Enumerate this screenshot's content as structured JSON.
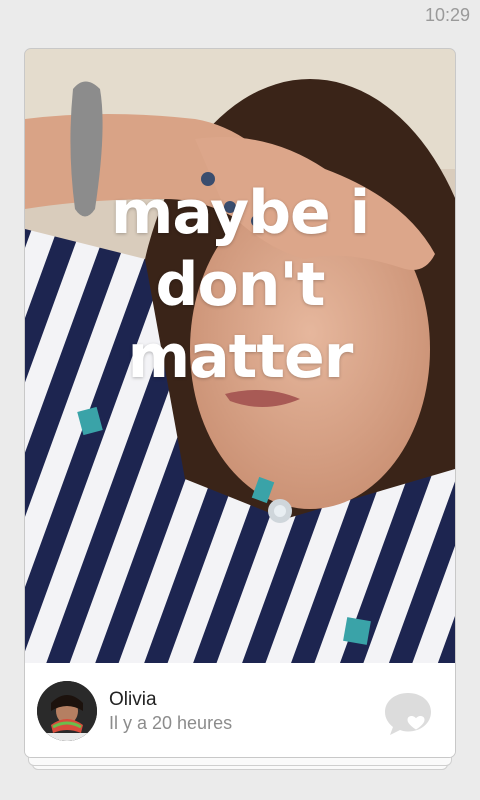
{
  "status_bar": {
    "time": "10:29"
  },
  "post": {
    "caption_lines": [
      "maybe i",
      "don't",
      "matter"
    ],
    "author": "Olivia",
    "timestamp": "Il y a 20 heures"
  },
  "icons": {
    "comment": "speech-bubble-heart-icon",
    "avatar": "user-avatar"
  },
  "colors": {
    "background": "#ebebeb",
    "caption_text": "#ffffff",
    "icon_gray": "#d9d9d9",
    "timestamp_gray": "#8c8c8c"
  }
}
